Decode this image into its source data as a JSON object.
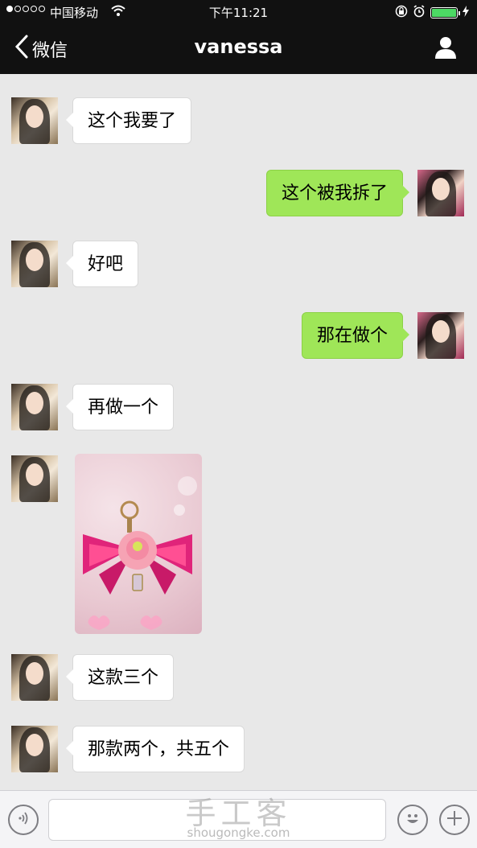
{
  "status_bar": {
    "carrier": "中国移动",
    "time": "下午11:21",
    "battery_level": 1.0
  },
  "nav": {
    "back_label": "微信",
    "title": "vanessa"
  },
  "messages": [
    {
      "side": "left",
      "text": "这个我要了"
    },
    {
      "side": "right",
      "text": "这个被我拆了"
    },
    {
      "side": "left",
      "text": "好吧"
    },
    {
      "side": "right",
      "text": "那在做个"
    },
    {
      "side": "left",
      "text": "再做一个"
    },
    {
      "side": "left",
      "type": "image"
    },
    {
      "side": "left",
      "text": "这款三个"
    },
    {
      "side": "left",
      "text": "那款两个，共五个"
    }
  ],
  "input_bar": {
    "placeholder": ""
  },
  "watermark": {
    "cn": "手工客",
    "en": "shougongke.com"
  },
  "colors": {
    "nav_bg": "#111111",
    "chat_bg": "#e8e8e8",
    "sent_bubble": "#9fe658",
    "received_bubble": "#ffffff"
  }
}
